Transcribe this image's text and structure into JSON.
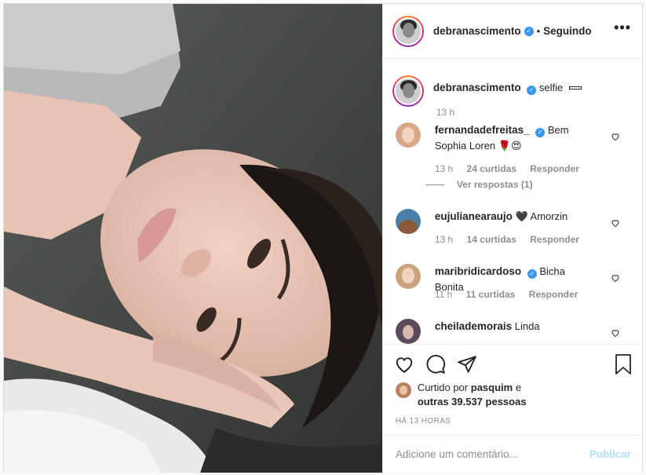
{
  "header": {
    "username": "debranascimento",
    "dot": "•",
    "follow_status": "Seguindo",
    "more": "•••"
  },
  "caption": {
    "username": "debranascimento",
    "text": "selfie",
    "time": "13 h"
  },
  "comments": [
    {
      "username": "fernandadefreitas_",
      "verified": true,
      "text": "Bem Sophia Loren 🌹😍",
      "time": "13 h",
      "likes": "24 curtidas",
      "reply": "Responder",
      "view_replies": "Ver respostas (1)"
    },
    {
      "username": "eujulianearaujo",
      "verified": false,
      "text": "🖤 Amorzin",
      "time": "13 h",
      "likes": "14 curtidas",
      "reply": "Responder"
    },
    {
      "username": "maribridicardoso",
      "verified": true,
      "text": "Bicha Bonita",
      "time": "11 h",
      "likes": "11 curtidas",
      "reply": "Responder"
    },
    {
      "username": "cheilademorais",
      "verified": false,
      "text": "Linda"
    }
  ],
  "likes": {
    "prefix": "Curtido por",
    "user": "pasquim",
    "connector": "e",
    "others": "outras 39.537 pessoas"
  },
  "time_ago": "HÁ 13 HORAS",
  "add_comment": {
    "placeholder": "Adicione um comentário...",
    "publish": "Publicar"
  },
  "icons": {
    "like": "heart-icon",
    "comment": "comment-bubble-icon",
    "share": "paper-plane-icon",
    "save": "bookmark-icon",
    "verified": "verified-badge-icon"
  },
  "colors": {
    "verified": "#3897f0",
    "publish_disabled": "#b2dffc",
    "muted": "#8e8e8e"
  }
}
